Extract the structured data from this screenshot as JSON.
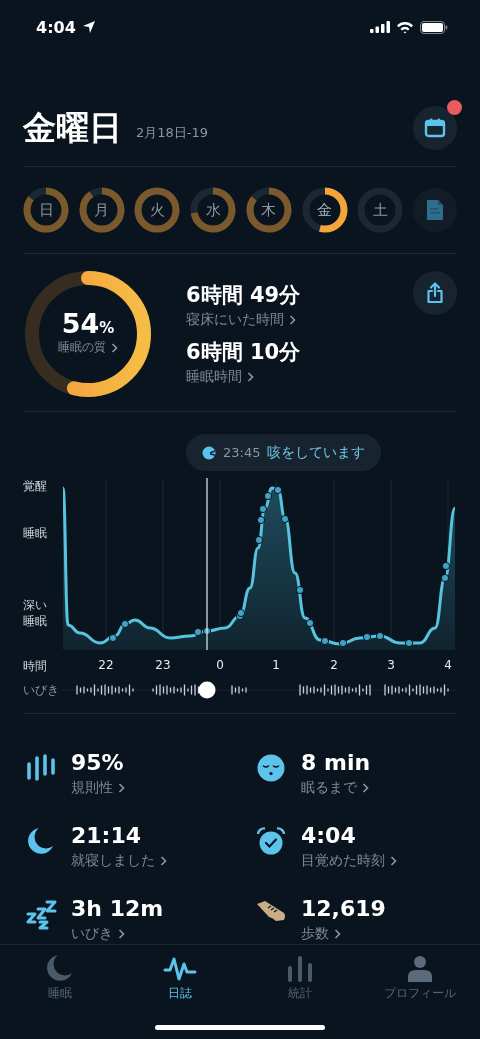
{
  "status_bar": {
    "time": "4:04"
  },
  "header": {
    "title": "金曜日",
    "date_range": "2月18日-19",
    "calendar_badge": true
  },
  "days": [
    {
      "label": "日",
      "selected": false
    },
    {
      "label": "月",
      "selected": false
    },
    {
      "label": "火",
      "selected": false
    },
    {
      "label": "水",
      "selected": false
    },
    {
      "label": "木",
      "selected": false
    },
    {
      "label": "金",
      "selected": true
    },
    {
      "label": "土",
      "selected": false
    }
  ],
  "summary": {
    "quality": {
      "value": "54",
      "unit": "%",
      "label": "睡眠の質"
    },
    "metrics": [
      {
        "value": "6時間 49分",
        "label": "寝床にいた時間"
      },
      {
        "value": "6時間 10分",
        "label": "睡眠時間"
      }
    ]
  },
  "event": {
    "time": "23:45",
    "text": "咳をしています"
  },
  "chart": {
    "y_labels": [
      "覚醒",
      "睡眠",
      "深い睡眠"
    ],
    "x_title": "時間",
    "x_labels": [
      "22",
      "23",
      "0",
      "1",
      "2",
      "3",
      "4"
    ],
    "snore_label": "いびき"
  },
  "stats": [
    {
      "kind": "regularity",
      "value": "95%",
      "label": "規則性"
    },
    {
      "kind": "fall-asleep",
      "value": "8 min",
      "label": "眠るまで"
    },
    {
      "kind": "bedtime",
      "value": "21:14",
      "label": "就寝しました"
    },
    {
      "kind": "wakeup",
      "value": "4:04",
      "label": "目覚めた時刻"
    },
    {
      "kind": "snore",
      "value": "3h 12m",
      "label": "いびき"
    },
    {
      "kind": "steps",
      "value": "12,619",
      "label": "歩数"
    }
  ],
  "tabs": [
    {
      "kind": "sleep",
      "label": "睡眠",
      "selected": false
    },
    {
      "kind": "journal",
      "label": "日誌",
      "selected": true
    },
    {
      "kind": "stats",
      "label": "統計",
      "selected": false
    },
    {
      "kind": "profile",
      "label": "プロフィール",
      "selected": false
    }
  ]
}
